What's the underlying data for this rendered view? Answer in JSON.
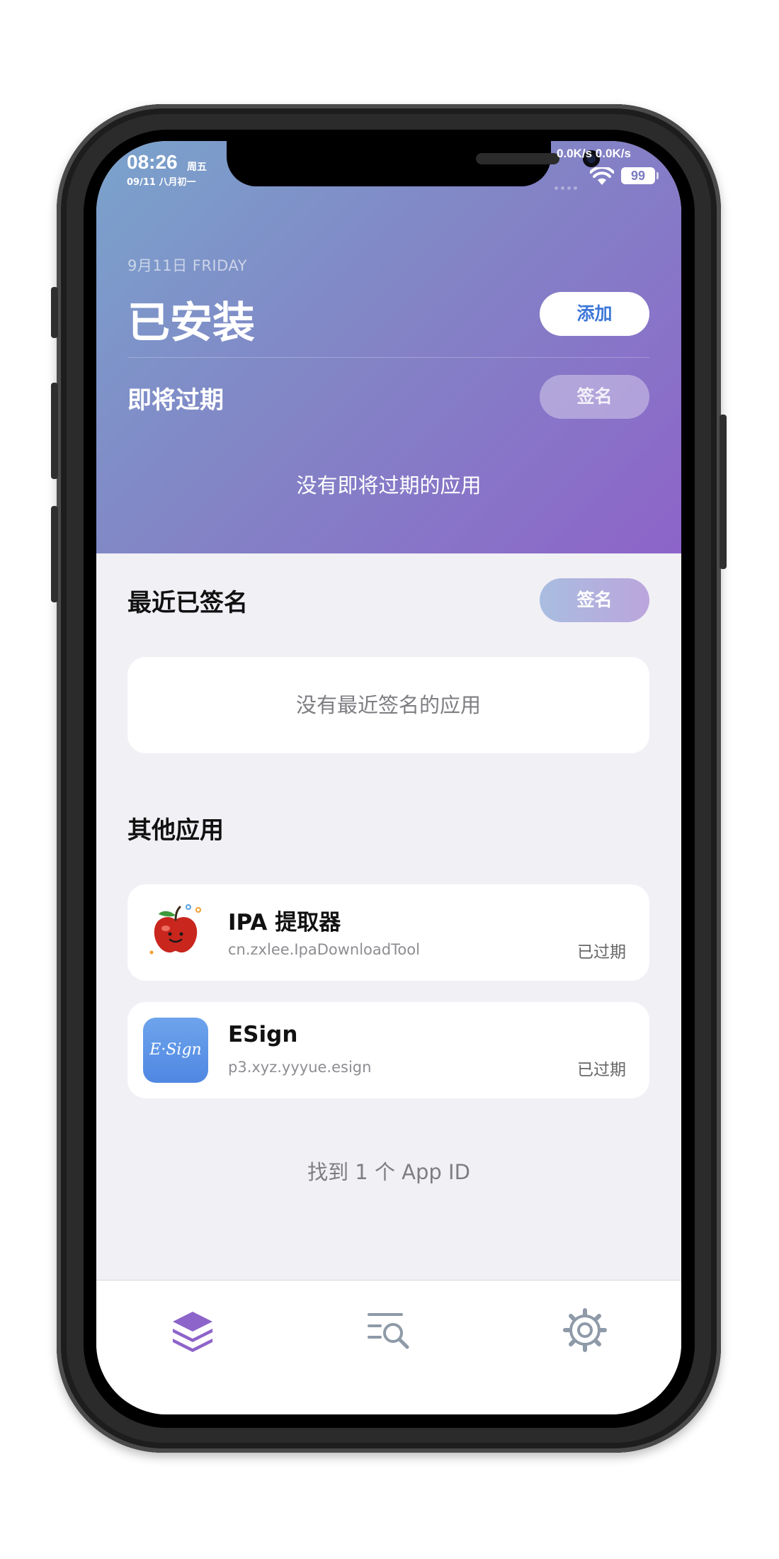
{
  "status_bar": {
    "time": "08:26",
    "weekday": "周五",
    "date": "09/11 八月初一",
    "net_speed": "0.0K/s 0.0K/s",
    "battery": "99"
  },
  "header": {
    "date_line": "9月11日 FRIDAY",
    "title": "已安装",
    "add_button": "添加",
    "expiring_title": "即将过期",
    "expiring_sign_button": "签名",
    "expiring_empty": "没有即将过期的应用"
  },
  "recent": {
    "title": "最近已签名",
    "sign_button": "签名",
    "empty": "没有最近签名的应用"
  },
  "other": {
    "title": "其他应用",
    "apps": [
      {
        "name": "IPA 提取器",
        "bundle": "cn.zxlee.IpaDownloadTool",
        "status": "已过期",
        "icon": "apple-icon"
      },
      {
        "name": "ESign",
        "bundle": "p3.xyz.yyyue.esign",
        "status": "已过期",
        "icon": "esign-icon",
        "icon_text": "E·Sign"
      }
    ]
  },
  "footer": {
    "count": "找到 1 个 App ID"
  },
  "tabbar": {
    "tabs": [
      {
        "icon": "layers-icon",
        "active": true
      },
      {
        "icon": "list-search-icon",
        "active": false
      },
      {
        "icon": "gear-icon",
        "active": false
      }
    ]
  },
  "colors": {
    "accent": "#8d64c9",
    "header_start": "#7aa3cc",
    "header_end": "#8d64c9",
    "link_blue": "#3d78d8",
    "background": "#f1f0f5"
  }
}
